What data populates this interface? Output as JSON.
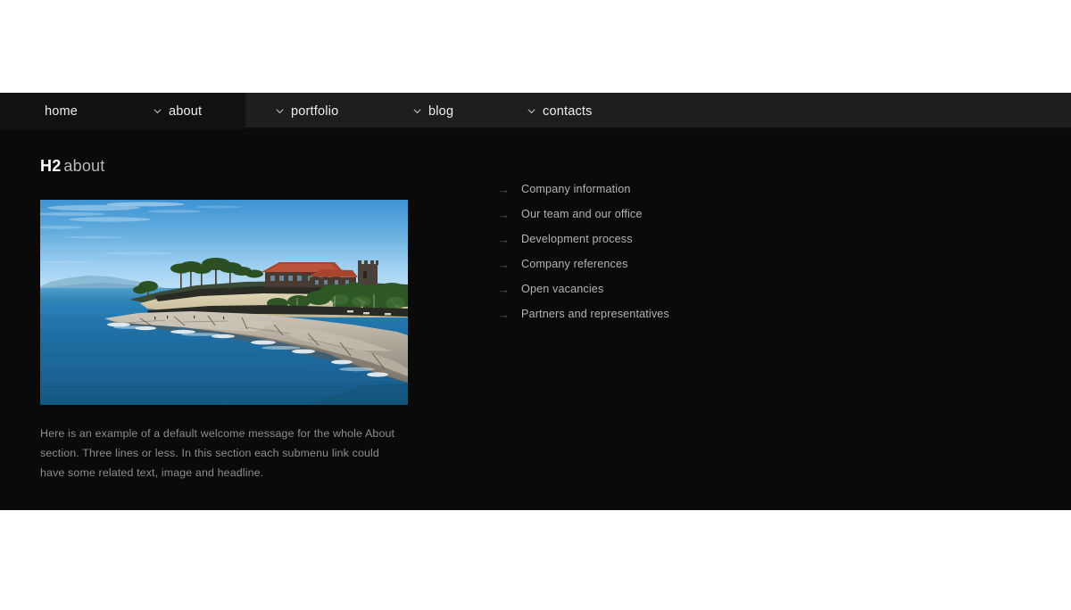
{
  "nav": {
    "items": [
      {
        "id": "home",
        "label": "home",
        "has_dropdown": false,
        "active": false
      },
      {
        "id": "about",
        "label": "about",
        "has_dropdown": true,
        "active": true
      },
      {
        "id": "portfolio",
        "label": "portfolio",
        "has_dropdown": true,
        "active": false
      },
      {
        "id": "blog",
        "label": "blog",
        "has_dropdown": true,
        "active": false
      },
      {
        "id": "contacts",
        "label": "contacts",
        "has_dropdown": true,
        "active": false
      }
    ],
    "dropdown_icon": "chevron-down-icon"
  },
  "heading": {
    "tag_label": "H2",
    "text": "about"
  },
  "photo": {
    "alt": "Coastal headland with rocky white cliffs, turquoise ocean, palm trees and a red-roofed hotel",
    "colors": {
      "sky_top": "#3f95d4",
      "sky_horizon": "#bcdff4",
      "ocean_deep": "#14608f",
      "ocean_mid": "#2277ab",
      "rock_light": "#b4ada2",
      "rock_shadow": "#6c665e",
      "foliage": "#2e5a22",
      "roof": "#b4472c",
      "wall_stone": "#30302b",
      "sand": "#ddd0ad"
    }
  },
  "intro": {
    "paragraph": "Here is an example of a default welcome message for the whole About section. Three lines or less. In this section each submenu link could have some related text, image and headline."
  },
  "sublinks": {
    "marker": "→",
    "items": [
      {
        "label": "Company information"
      },
      {
        "label": "Our team and our office"
      },
      {
        "label": "Development process"
      },
      {
        "label": "Company references"
      },
      {
        "label": "Open vacancies"
      },
      {
        "label": "Partners and representatives"
      }
    ]
  },
  "theme": {
    "page_background": "#ffffff",
    "content_background": "#0a0a0a",
    "nav_background_left": "#111111",
    "nav_background_right": "#1e1e1e",
    "text_primary": "#ffffff",
    "text_secondary": "#b3b3b3",
    "text_muted": "#8e8e8e"
  }
}
